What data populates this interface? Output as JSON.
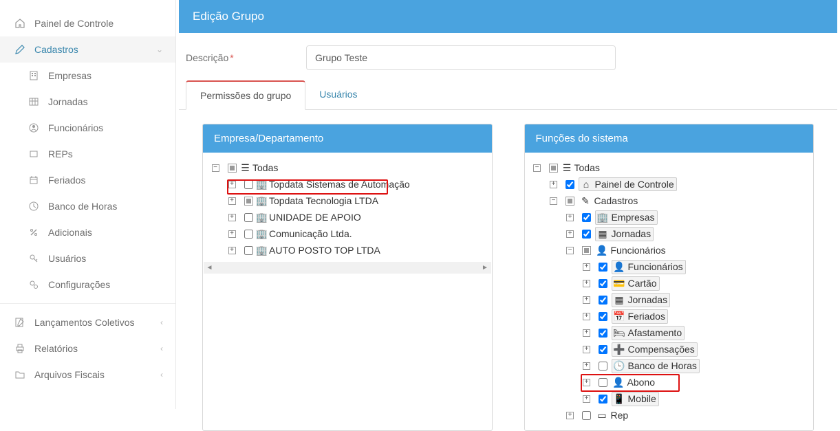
{
  "sidebar": {
    "painel": "Painel de Controle",
    "cadastros": "Cadastros",
    "items": [
      "Empresas",
      "Jornadas",
      "Funcionários",
      "REPs",
      "Feriados",
      "Banco de Horas",
      "Adicionais",
      "Usuários",
      "Configurações"
    ],
    "lancamentos": "Lançamentos Coletivos",
    "relatorios": "Relatórios",
    "arquivos": "Arquivos Fiscais"
  },
  "page": {
    "title": "Edição Grupo",
    "desc_label": "Descrição",
    "desc_value": "Grupo Teste"
  },
  "tabs": {
    "permissoes": "Permissões do grupo",
    "usuarios": "Usuários"
  },
  "panel_left": {
    "title": "Empresa/Departamento",
    "root": "Todas",
    "items": [
      "Topdata Sistemas de Automação",
      "Topdata Tecnologia LTDA",
      "UNIDADE DE APOIO",
      "Comunicação Ltda.",
      "AUTO POSTO TOP LTDA"
    ]
  },
  "panel_right": {
    "title": "Funções do sistema",
    "root": "Todas",
    "painel": "Painel de Controle",
    "cadastros": "Cadastros",
    "empresas": "Empresas",
    "jornadas": "Jornadas",
    "funcionarios": "Funcionários",
    "sub_funcionarios": [
      "Funcionários",
      "Cartão",
      "Jornadas",
      "Feriados",
      "Afastamento",
      "Compensações",
      "Banco de Horas",
      "Abono",
      "Mobile"
    ],
    "rep": "Rep"
  }
}
